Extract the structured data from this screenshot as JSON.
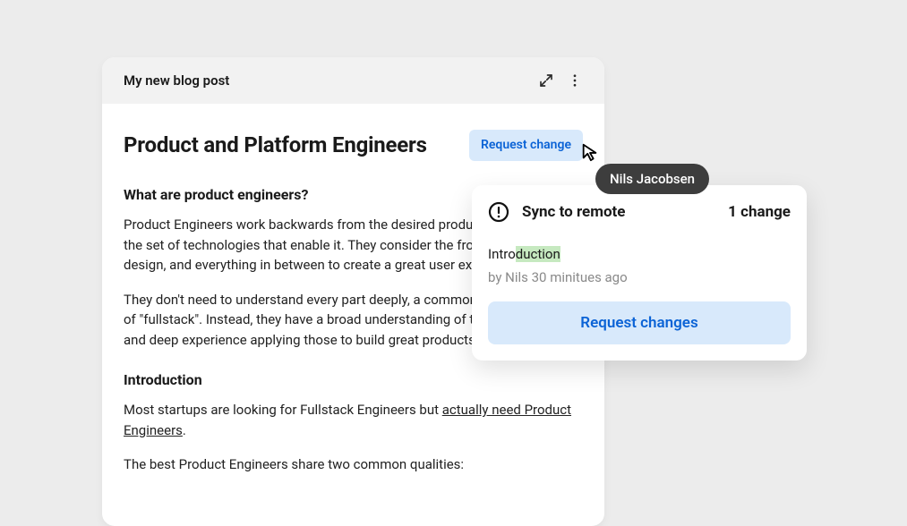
{
  "editor": {
    "window_title": "My new blog post",
    "doc_title": "Product and Platform Engineers",
    "request_change_label": "Request change",
    "sections": {
      "s1_heading": "What are product engineers?",
      "s1_p1": "Product Engineers work backwards from the desired product experience to the set of technologies that enable it. They consider the frontend, backend, design, and everything in between to create a great user experience.",
      "s1_p2": "They don't need to understand every part deeply, a common misconception of \"fullstack\". Instead, they have a broad understanding of the available tools and deep experience applying those to build great products.",
      "s2_heading": "Introduction",
      "s2_p1_a": "Most startups are looking for Fullstack Engineers but ",
      "s2_p1_link": "actually need Product Engineers",
      "s2_p1_b": ".",
      "s2_p2": "The best Product Engineers share two common qualities:"
    }
  },
  "popover": {
    "title": "Sync to remote",
    "count_label": "1 change",
    "changed_word_prefix": "Intro",
    "changed_word_highlight": "duction",
    "byline": "by Nils 30 minitues ago",
    "button_label": "Request changes"
  },
  "cursor_user": "Nils Jacobsen"
}
